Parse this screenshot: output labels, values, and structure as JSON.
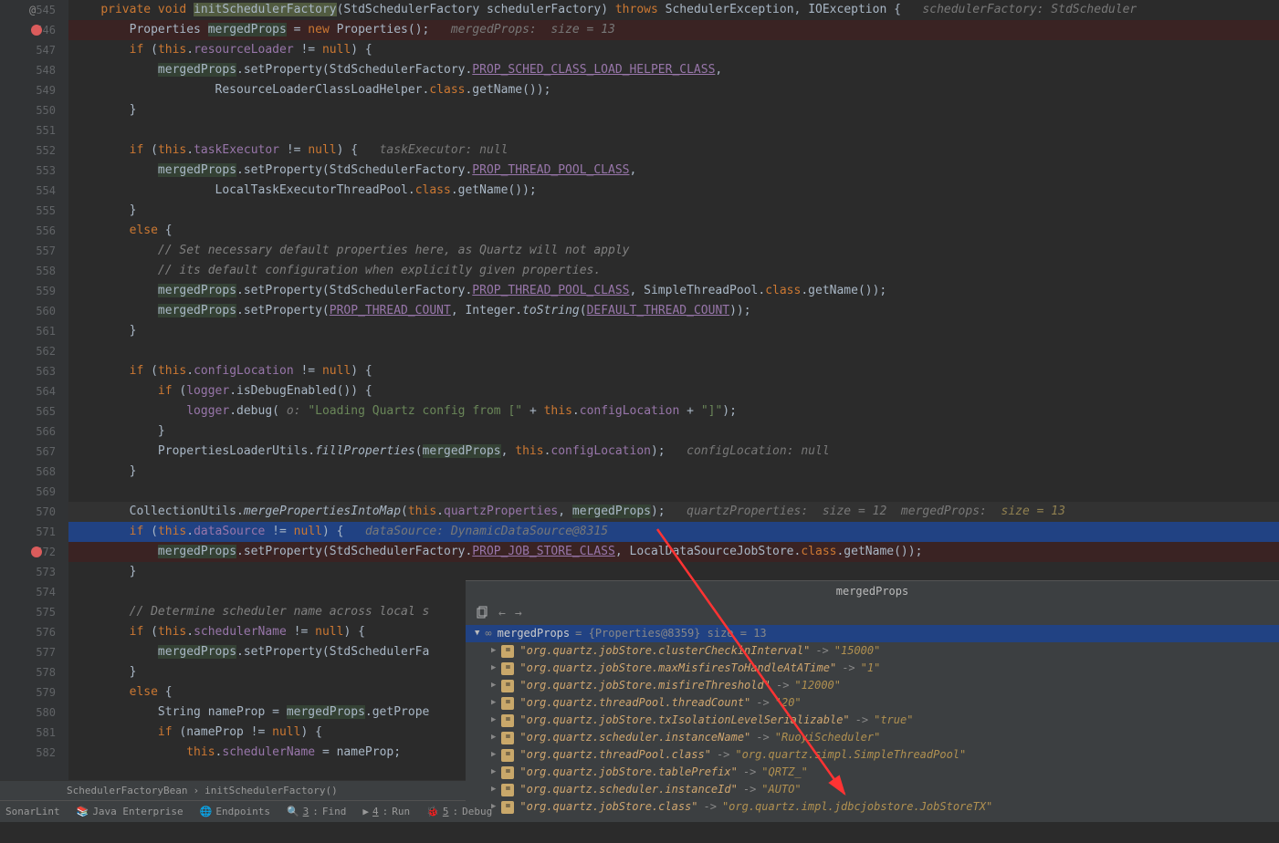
{
  "gutter": {
    "start": 545,
    "end": 582,
    "at_line": 545,
    "breakpoints": [
      546,
      572
    ],
    "exec_line": 571
  },
  "code": [
    {
      "n": 545,
      "cls": "",
      "frags": [
        {
          "t": "    ",
          "c": ""
        },
        {
          "t": "private void ",
          "c": "kw"
        },
        {
          "t": "initSchedulerFactory",
          "c": "bg-y"
        },
        {
          "t": "(StdSchedulerFactory schedulerFactory) ",
          "c": ""
        },
        {
          "t": "throws ",
          "c": "kw"
        },
        {
          "t": "SchedulerException, IOException {   ",
          "c": ""
        },
        {
          "t": "schedulerFactory: StdScheduler",
          "c": "cmt-hint"
        }
      ]
    },
    {
      "n": 546,
      "cls": "hl-red",
      "frags": [
        {
          "t": "        Properties ",
          "c": ""
        },
        {
          "t": "mergedProps",
          "c": "bg-g"
        },
        {
          "t": " = ",
          "c": ""
        },
        {
          "t": "new ",
          "c": "kw"
        },
        {
          "t": "Properties();   ",
          "c": ""
        },
        {
          "t": "mergedProps:  size = 13",
          "c": "cmt-hint"
        }
      ]
    },
    {
      "n": 547,
      "cls": "",
      "frags": [
        {
          "t": "        ",
          "c": ""
        },
        {
          "t": "if ",
          "c": "kw"
        },
        {
          "t": "(",
          "c": ""
        },
        {
          "t": "this",
          "c": "kw"
        },
        {
          "t": ".",
          "c": ""
        },
        {
          "t": "resourceLoader",
          "c": "fld"
        },
        {
          "t": " != ",
          "c": ""
        },
        {
          "t": "null",
          "c": "kw"
        },
        {
          "t": ") {",
          "c": ""
        }
      ]
    },
    {
      "n": 548,
      "cls": "",
      "frags": [
        {
          "t": "            ",
          "c": ""
        },
        {
          "t": "mergedProps",
          "c": "bg-g"
        },
        {
          "t": ".setProperty(StdSchedulerFactory.",
          "c": ""
        },
        {
          "t": "PROP_SCHED_CLASS_LOAD_HELPER_CLASS",
          "c": "fld-u"
        },
        {
          "t": ",",
          "c": ""
        }
      ]
    },
    {
      "n": 549,
      "cls": "",
      "frags": [
        {
          "t": "                    ResourceLoaderClassLoadHelper.",
          "c": ""
        },
        {
          "t": "class",
          "c": "kw"
        },
        {
          "t": ".getName());",
          "c": ""
        }
      ]
    },
    {
      "n": 550,
      "cls": "",
      "frags": [
        {
          "t": "        }",
          "c": ""
        }
      ]
    },
    {
      "n": 551,
      "cls": "",
      "frags": [
        {
          "t": "",
          "c": ""
        }
      ]
    },
    {
      "n": 552,
      "cls": "",
      "frags": [
        {
          "t": "        ",
          "c": ""
        },
        {
          "t": "if ",
          "c": "kw"
        },
        {
          "t": "(",
          "c": ""
        },
        {
          "t": "this",
          "c": "kw"
        },
        {
          "t": ".",
          "c": ""
        },
        {
          "t": "taskExecutor",
          "c": "fld"
        },
        {
          "t": " != ",
          "c": ""
        },
        {
          "t": "null",
          "c": "kw"
        },
        {
          "t": ") {   ",
          "c": ""
        },
        {
          "t": "taskExecutor: null",
          "c": "cmt-hint"
        }
      ]
    },
    {
      "n": 553,
      "cls": "",
      "frags": [
        {
          "t": "            ",
          "c": ""
        },
        {
          "t": "mergedProps",
          "c": "bg-g"
        },
        {
          "t": ".setProperty(StdSchedulerFactory.",
          "c": ""
        },
        {
          "t": "PROP_THREAD_POOL_CLASS",
          "c": "fld-u"
        },
        {
          "t": ",",
          "c": ""
        }
      ]
    },
    {
      "n": 554,
      "cls": "",
      "frags": [
        {
          "t": "                    LocalTaskExecutorThreadPool.",
          "c": ""
        },
        {
          "t": "class",
          "c": "kw"
        },
        {
          "t": ".getName());",
          "c": ""
        }
      ]
    },
    {
      "n": 555,
      "cls": "",
      "frags": [
        {
          "t": "        }",
          "c": ""
        }
      ]
    },
    {
      "n": 556,
      "cls": "",
      "frags": [
        {
          "t": "        ",
          "c": ""
        },
        {
          "t": "else ",
          "c": "kw"
        },
        {
          "t": "{",
          "c": ""
        }
      ]
    },
    {
      "n": 557,
      "cls": "",
      "frags": [
        {
          "t": "            ",
          "c": ""
        },
        {
          "t": "// Set necessary default properties here, as Quartz will not apply",
          "c": "cmt"
        }
      ]
    },
    {
      "n": 558,
      "cls": "",
      "frags": [
        {
          "t": "            ",
          "c": ""
        },
        {
          "t": "// its default configuration when explicitly given properties.",
          "c": "cmt"
        }
      ]
    },
    {
      "n": 559,
      "cls": "",
      "frags": [
        {
          "t": "            ",
          "c": ""
        },
        {
          "t": "mergedProps",
          "c": "bg-g"
        },
        {
          "t": ".setProperty(StdSchedulerFactory.",
          "c": ""
        },
        {
          "t": "PROP_THREAD_POOL_CLASS",
          "c": "fld-u"
        },
        {
          "t": ", SimpleThreadPool.",
          "c": ""
        },
        {
          "t": "class",
          "c": "kw"
        },
        {
          "t": ".getName());",
          "c": ""
        }
      ]
    },
    {
      "n": 560,
      "cls": "",
      "frags": [
        {
          "t": "            ",
          "c": ""
        },
        {
          "t": "mergedProps",
          "c": "bg-g"
        },
        {
          "t": ".setProperty(",
          "c": ""
        },
        {
          "t": "PROP_THREAD_COUNT",
          "c": "fld-u"
        },
        {
          "t": ", Integer.",
          "c": ""
        },
        {
          "t": "toString",
          "c": "mtd"
        },
        {
          "t": "(",
          "c": ""
        },
        {
          "t": "DEFAULT_THREAD_COUNT",
          "c": "fld-u"
        },
        {
          "t": "));",
          "c": ""
        }
      ]
    },
    {
      "n": 561,
      "cls": "",
      "frags": [
        {
          "t": "        }",
          "c": ""
        }
      ]
    },
    {
      "n": 562,
      "cls": "",
      "frags": [
        {
          "t": "",
          "c": ""
        }
      ]
    },
    {
      "n": 563,
      "cls": "",
      "frags": [
        {
          "t": "        ",
          "c": ""
        },
        {
          "t": "if ",
          "c": "kw"
        },
        {
          "t": "(",
          "c": ""
        },
        {
          "t": "this",
          "c": "kw"
        },
        {
          "t": ".",
          "c": ""
        },
        {
          "t": "configLocation",
          "c": "fld"
        },
        {
          "t": " != ",
          "c": ""
        },
        {
          "t": "null",
          "c": "kw"
        },
        {
          "t": ") {",
          "c": ""
        }
      ]
    },
    {
      "n": 564,
      "cls": "",
      "frags": [
        {
          "t": "            ",
          "c": ""
        },
        {
          "t": "if ",
          "c": "kw"
        },
        {
          "t": "(",
          "c": ""
        },
        {
          "t": "logger",
          "c": "fld"
        },
        {
          "t": ".isDebugEnabled()) {",
          "c": ""
        }
      ]
    },
    {
      "n": 565,
      "cls": "",
      "frags": [
        {
          "t": "                ",
          "c": ""
        },
        {
          "t": "logger",
          "c": "fld"
        },
        {
          "t": ".debug( ",
          "c": ""
        },
        {
          "t": "o: ",
          "c": "cmt-hint"
        },
        {
          "t": "\"Loading Quartz config from [\"",
          "c": "str"
        },
        {
          "t": " + ",
          "c": ""
        },
        {
          "t": "this",
          "c": "kw"
        },
        {
          "t": ".",
          "c": ""
        },
        {
          "t": "configLocation",
          "c": "fld"
        },
        {
          "t": " + ",
          "c": ""
        },
        {
          "t": "\"]\"",
          "c": "str"
        },
        {
          "t": ");",
          "c": ""
        }
      ]
    },
    {
      "n": 566,
      "cls": "",
      "frags": [
        {
          "t": "            }",
          "c": ""
        }
      ]
    },
    {
      "n": 567,
      "cls": "",
      "frags": [
        {
          "t": "            PropertiesLoaderUtils.",
          "c": ""
        },
        {
          "t": "fillProperties",
          "c": "mtd"
        },
        {
          "t": "(",
          "c": ""
        },
        {
          "t": "mergedProps",
          "c": "bg-g"
        },
        {
          "t": ", ",
          "c": ""
        },
        {
          "t": "this",
          "c": "kw"
        },
        {
          "t": ".",
          "c": ""
        },
        {
          "t": "configLocation",
          "c": "fld"
        },
        {
          "t": ");   ",
          "c": ""
        },
        {
          "t": "configLocation: null",
          "c": "cmt-hint"
        }
      ]
    },
    {
      "n": 568,
      "cls": "",
      "frags": [
        {
          "t": "        }",
          "c": ""
        }
      ]
    },
    {
      "n": 569,
      "cls": "",
      "frags": [
        {
          "t": "",
          "c": ""
        }
      ]
    },
    {
      "n": 570,
      "cls": "hl-dark",
      "frags": [
        {
          "t": "        CollectionUtils.",
          "c": ""
        },
        {
          "t": "mergePropertiesIntoMap",
          "c": "mtd"
        },
        {
          "t": "(",
          "c": ""
        },
        {
          "t": "this",
          "c": "kw"
        },
        {
          "t": ".",
          "c": ""
        },
        {
          "t": "quartzProperties",
          "c": "fld"
        },
        {
          "t": ", ",
          "c": ""
        },
        {
          "t": "mergedProps",
          "c": "bg-g"
        },
        {
          "t": ");   ",
          "c": ""
        },
        {
          "t": "quartzProperties:  size = 12  mergedProps:  ",
          "c": "cmt-hint"
        },
        {
          "t": "size = 13",
          "c": "hint-y"
        }
      ]
    },
    {
      "n": 571,
      "cls": "hl-blue",
      "frags": [
        {
          "t": "        ",
          "c": ""
        },
        {
          "t": "if ",
          "c": "kw"
        },
        {
          "t": "(",
          "c": ""
        },
        {
          "t": "this",
          "c": "kw"
        },
        {
          "t": ".",
          "c": ""
        },
        {
          "t": "dataSource",
          "c": "fld"
        },
        {
          "t": " != ",
          "c": ""
        },
        {
          "t": "null",
          "c": "kw"
        },
        {
          "t": ") {   ",
          "c": ""
        },
        {
          "t": "dataSource: DynamicDataSource@8315",
          "c": "cmt-hint"
        }
      ]
    },
    {
      "n": 572,
      "cls": "hl-red",
      "frags": [
        {
          "t": "            ",
          "c": ""
        },
        {
          "t": "mergedProps",
          "c": "bg-g"
        },
        {
          "t": ".setProperty(StdSchedulerFactory.",
          "c": ""
        },
        {
          "t": "PROP_JOB_STORE_CLASS",
          "c": "fld-u"
        },
        {
          "t": ", LocalDataSourceJobStore.",
          "c": ""
        },
        {
          "t": "class",
          "c": "kw"
        },
        {
          "t": ".getName());",
          "c": ""
        }
      ]
    },
    {
      "n": 573,
      "cls": "",
      "frags": [
        {
          "t": "        }",
          "c": ""
        }
      ]
    },
    {
      "n": 574,
      "cls": "",
      "frags": [
        {
          "t": "",
          "c": ""
        }
      ]
    },
    {
      "n": 575,
      "cls": "",
      "frags": [
        {
          "t": "        ",
          "c": ""
        },
        {
          "t": "// Determine scheduler name across local s",
          "c": "cmt"
        }
      ]
    },
    {
      "n": 576,
      "cls": "",
      "frags": [
        {
          "t": "        ",
          "c": ""
        },
        {
          "t": "if ",
          "c": "kw"
        },
        {
          "t": "(",
          "c": ""
        },
        {
          "t": "this",
          "c": "kw"
        },
        {
          "t": ".",
          "c": ""
        },
        {
          "t": "schedulerName",
          "c": "fld"
        },
        {
          "t": " != ",
          "c": ""
        },
        {
          "t": "null",
          "c": "kw"
        },
        {
          "t": ") {",
          "c": ""
        }
      ]
    },
    {
      "n": 577,
      "cls": "",
      "frags": [
        {
          "t": "            ",
          "c": ""
        },
        {
          "t": "mergedProps",
          "c": "bg-g"
        },
        {
          "t": ".setProperty(StdSchedulerFa",
          "c": ""
        }
      ]
    },
    {
      "n": 578,
      "cls": "",
      "frags": [
        {
          "t": "        }",
          "c": ""
        }
      ]
    },
    {
      "n": 579,
      "cls": "",
      "frags": [
        {
          "t": "        ",
          "c": ""
        },
        {
          "t": "else ",
          "c": "kw"
        },
        {
          "t": "{",
          "c": ""
        }
      ]
    },
    {
      "n": 580,
      "cls": "",
      "frags": [
        {
          "t": "            String nameProp = ",
          "c": ""
        },
        {
          "t": "mergedProps",
          "c": "bg-g"
        },
        {
          "t": ".getPrope",
          "c": ""
        }
      ]
    },
    {
      "n": 581,
      "cls": "",
      "frags": [
        {
          "t": "            ",
          "c": ""
        },
        {
          "t": "if ",
          "c": "kw"
        },
        {
          "t": "(nameProp != ",
          "c": ""
        },
        {
          "t": "null",
          "c": "kw"
        },
        {
          "t": ") {",
          "c": ""
        }
      ]
    },
    {
      "n": 582,
      "cls": "",
      "frags": [
        {
          "t": "                ",
          "c": ""
        },
        {
          "t": "this",
          "c": "kw"
        },
        {
          "t": ".",
          "c": ""
        },
        {
          "t": "schedulerName",
          "c": "fld"
        },
        {
          "t": " = nameProp;",
          "c": ""
        }
      ]
    }
  ],
  "breadcrumb": {
    "class": "SchedulerFactoryBean",
    "method": "initSchedulerFactory()"
  },
  "status": {
    "sonarlint": "SonarLint",
    "java_ent": "Java Enterprise",
    "endpoints": "Endpoints",
    "find": "Find",
    "find_key": "3",
    "run": "Run",
    "run_key": "4",
    "debug": "Debug",
    "debug_key": "5"
  },
  "debug": {
    "title": "mergedProps",
    "root": {
      "name": "mergedProps",
      "type": "{Properties@8359}",
      "size": "size = 13"
    },
    "entries": [
      {
        "k": "\"org.quartz.jobStore.clusterCheckinInterval\"",
        "v": "\"15000\""
      },
      {
        "k": "\"org.quartz.jobStore.maxMisfiresToHandleAtATime\"",
        "v": "\"1\""
      },
      {
        "k": "\"org.quartz.jobStore.misfireThreshold\"",
        "v": "\"12000\""
      },
      {
        "k": "\"org.quartz.threadPool.threadCount\"",
        "v": "\"20\""
      },
      {
        "k": "\"org.quartz.jobStore.txIsolationLevelSerializable\"",
        "v": "\"true\""
      },
      {
        "k": "\"org.quartz.scheduler.instanceName\"",
        "v": "\"RuoyiScheduler\""
      },
      {
        "k": "\"org.quartz.threadPool.class\"",
        "v": "\"org.quartz.simpl.SimpleThreadPool\""
      },
      {
        "k": "\"org.quartz.jobStore.tablePrefix\"",
        "v": "\"QRTZ_\""
      },
      {
        "k": "\"org.quartz.scheduler.instanceId\"",
        "v": "\"AUTO\""
      },
      {
        "k": "\"org.quartz.jobStore.class\"",
        "v": "\"org.quartz.impl.jdbcjobstore.JobStoreTX\""
      }
    ]
  }
}
